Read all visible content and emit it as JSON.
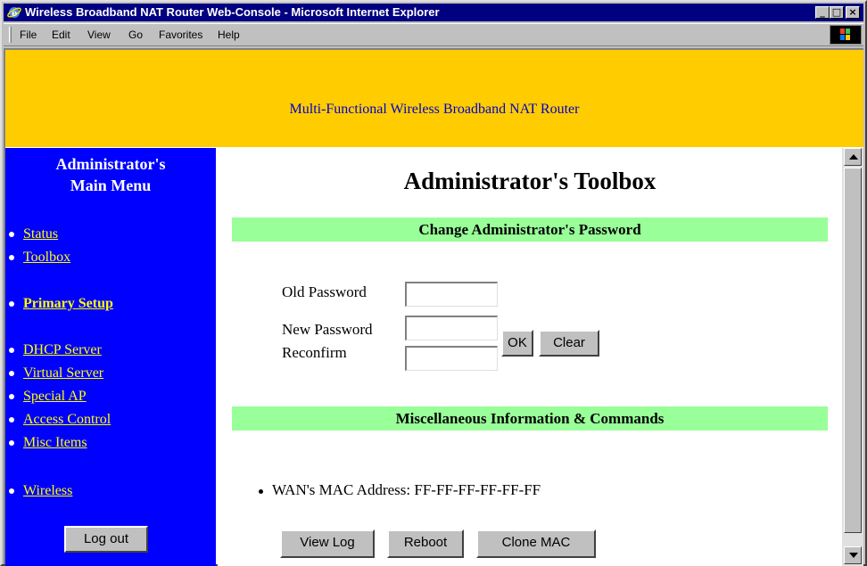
{
  "window": {
    "title": "Wireless Broadband NAT Router Web-Console - Microsoft Internet Explorer"
  },
  "menubar": {
    "items": [
      "File",
      "Edit",
      "View",
      "Go",
      "Favorites",
      "Help"
    ]
  },
  "banner": {
    "text": "Multi-Functional Wireless Broadband NAT Router",
    "background": "#ffcc00",
    "text_color": "#0000cc"
  },
  "sidebar": {
    "title_line1": "Administrator's",
    "title_line2": "Main Menu",
    "background": "#0000ff",
    "link_color": "#ffff00",
    "items": [
      {
        "label": "Status"
      },
      {
        "label": "Toolbox"
      },
      {
        "label": "Primary Setup"
      },
      {
        "label": "DHCP Server"
      },
      {
        "label": "Virtual Server"
      },
      {
        "label": "Special AP"
      },
      {
        "label": "Access Control"
      },
      {
        "label": "Misc Items"
      },
      {
        "label": "Wireless"
      }
    ],
    "logout_label": "Log out"
  },
  "main": {
    "title": "Administrator's Toolbox",
    "password_section": {
      "heading": "Change Administrator's Password",
      "old_password_label": "Old Password",
      "new_password_label": "New Password",
      "reconfirm_label": "Reconfirm",
      "ok_label": "OK",
      "clear_label": "Clear"
    },
    "misc_section": {
      "heading": "Miscellaneous Information & Commands",
      "wan_mac_text": "WAN's MAC Address: FF-FF-FF-FF-FF-FF",
      "view_log_label": "View Log",
      "reboot_label": "Reboot",
      "clone_mac_label": "Clone MAC"
    },
    "section_color": "#99ff99"
  }
}
